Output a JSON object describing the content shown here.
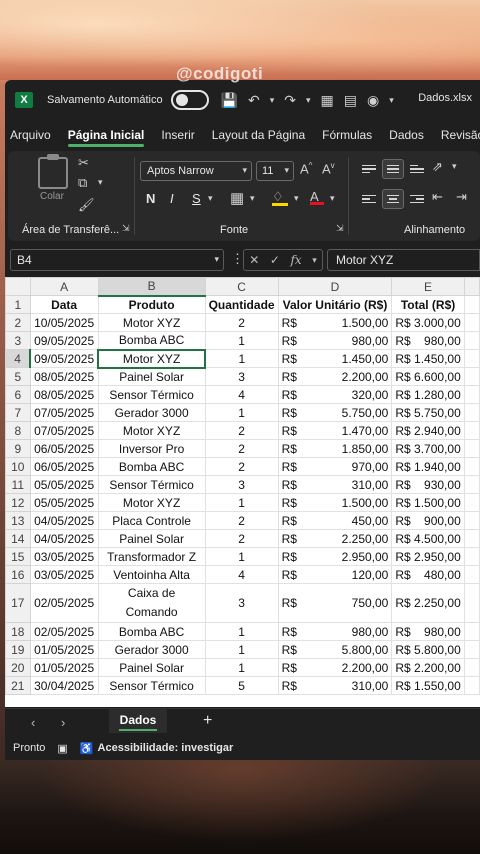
{
  "watermark": "@codigoti",
  "titlebar": {
    "logo": "X",
    "autosave_label": "Salvamento Automático",
    "filename": "Dados.xlsx"
  },
  "tabs": [
    {
      "label": "Arquivo"
    },
    {
      "label": "Página Inicial"
    },
    {
      "label": "Inserir"
    },
    {
      "label": "Layout da Página"
    },
    {
      "label": "Fórmulas"
    },
    {
      "label": "Dados"
    },
    {
      "label": "Revisão"
    }
  ],
  "ribbon": {
    "paste_label": "Colar",
    "clipboard_label": "Área de Transferê...",
    "font_name": "Aptos Narrow",
    "font_size": "11",
    "bold": "N",
    "italic": "I",
    "underline": "S",
    "font_group_label": "Fonte",
    "align_group_label": "Alinhamento",
    "font_color_accent": "#e81123",
    "highlight_accent": "#ffd800"
  },
  "formula_bar": {
    "name_box": "B4",
    "fx": "fx",
    "value": "Motor XYZ"
  },
  "columns": [
    "A",
    "B",
    "C",
    "D",
    "E"
  ],
  "header_row": [
    "Data",
    "Produto",
    "Quantidade",
    "Valor Unitário (R$)",
    "Total (R$)"
  ],
  "rows": [
    {
      "n": "2",
      "date": "10/05/2025",
      "product": "Motor XYZ",
      "qty": "2",
      "cur": "R$",
      "unit": "1.500,00",
      "total": "R$ 3.000,00"
    },
    {
      "n": "3",
      "date": "09/05/2025",
      "product": "Bomba ABC",
      "qty": "1",
      "cur": "R$",
      "unit": "980,00",
      "total": "R$    980,00"
    },
    {
      "n": "4",
      "date": "09/05/2025",
      "product": "Motor XYZ",
      "qty": "1",
      "cur": "R$",
      "unit": "1.450,00",
      "total": "R$ 1.450,00"
    },
    {
      "n": "5",
      "date": "08/05/2025",
      "product": "Painel Solar",
      "qty": "3",
      "cur": "R$",
      "unit": "2.200,00",
      "total": "R$ 6.600,00"
    },
    {
      "n": "6",
      "date": "08/05/2025",
      "product": "Sensor Térmico",
      "qty": "4",
      "cur": "R$",
      "unit": "320,00",
      "total": "R$ 1.280,00"
    },
    {
      "n": "7",
      "date": "07/05/2025",
      "product": "Gerador 3000",
      "qty": "1",
      "cur": "R$",
      "unit": "5.750,00",
      "total": "R$ 5.750,00"
    },
    {
      "n": "8",
      "date": "07/05/2025",
      "product": "Motor XYZ",
      "qty": "2",
      "cur": "R$",
      "unit": "1.470,00",
      "total": "R$ 2.940,00"
    },
    {
      "n": "9",
      "date": "06/05/2025",
      "product": "Inversor Pro",
      "qty": "2",
      "cur": "R$",
      "unit": "1.850,00",
      "total": "R$ 3.700,00"
    },
    {
      "n": "10",
      "date": "06/05/2025",
      "product": "Bomba ABC",
      "qty": "2",
      "cur": "R$",
      "unit": "970,00",
      "total": "R$ 1.940,00"
    },
    {
      "n": "11",
      "date": "05/05/2025",
      "product": "Sensor Térmico",
      "qty": "3",
      "cur": "R$",
      "unit": "310,00",
      "total": "R$    930,00"
    },
    {
      "n": "12",
      "date": "05/05/2025",
      "product": "Motor XYZ",
      "qty": "1",
      "cur": "R$",
      "unit": "1.500,00",
      "total": "R$ 1.500,00"
    },
    {
      "n": "13",
      "date": "04/05/2025",
      "product": "Placa Controle",
      "qty": "2",
      "cur": "R$",
      "unit": "450,00",
      "total": "R$    900,00"
    },
    {
      "n": "14",
      "date": "04/05/2025",
      "product": "Painel Solar",
      "qty": "2",
      "cur": "R$",
      "unit": "2.250,00",
      "total": "R$ 4.500,00"
    },
    {
      "n": "15",
      "date": "03/05/2025",
      "product": "Transformador Z",
      "qty": "1",
      "cur": "R$",
      "unit": "2.950,00",
      "total": "R$ 2.950,00"
    },
    {
      "n": "16",
      "date": "03/05/2025",
      "product": "Ventoinha Alta",
      "qty": "4",
      "cur": "R$",
      "unit": "120,00",
      "total": "R$    480,00"
    },
    {
      "n": "17",
      "date": "02/05/2025",
      "product": "Caixa de Comando",
      "qty": "3",
      "cur": "R$",
      "unit": "750,00",
      "total": "R$ 2.250,00"
    },
    {
      "n": "18",
      "date": "02/05/2025",
      "product": "Bomba ABC",
      "qty": "1",
      "cur": "R$",
      "unit": "980,00",
      "total": "R$    980,00"
    },
    {
      "n": "19",
      "date": "01/05/2025",
      "product": "Gerador 3000",
      "qty": "1",
      "cur": "R$",
      "unit": "5.800,00",
      "total": "R$ 5.800,00"
    },
    {
      "n": "20",
      "date": "01/05/2025",
      "product": "Painel Solar",
      "qty": "1",
      "cur": "R$",
      "unit": "2.200,00",
      "total": "R$ 2.200,00"
    },
    {
      "n": "21",
      "date": "30/04/2025",
      "product": "Sensor Térmico",
      "qty": "5",
      "cur": "R$",
      "unit": "310,00",
      "total": "R$ 1.550,00"
    }
  ],
  "sheet_tab": "Dados",
  "status": {
    "ready": "Pronto",
    "accessibility": "Acessibilidade: investigar"
  }
}
